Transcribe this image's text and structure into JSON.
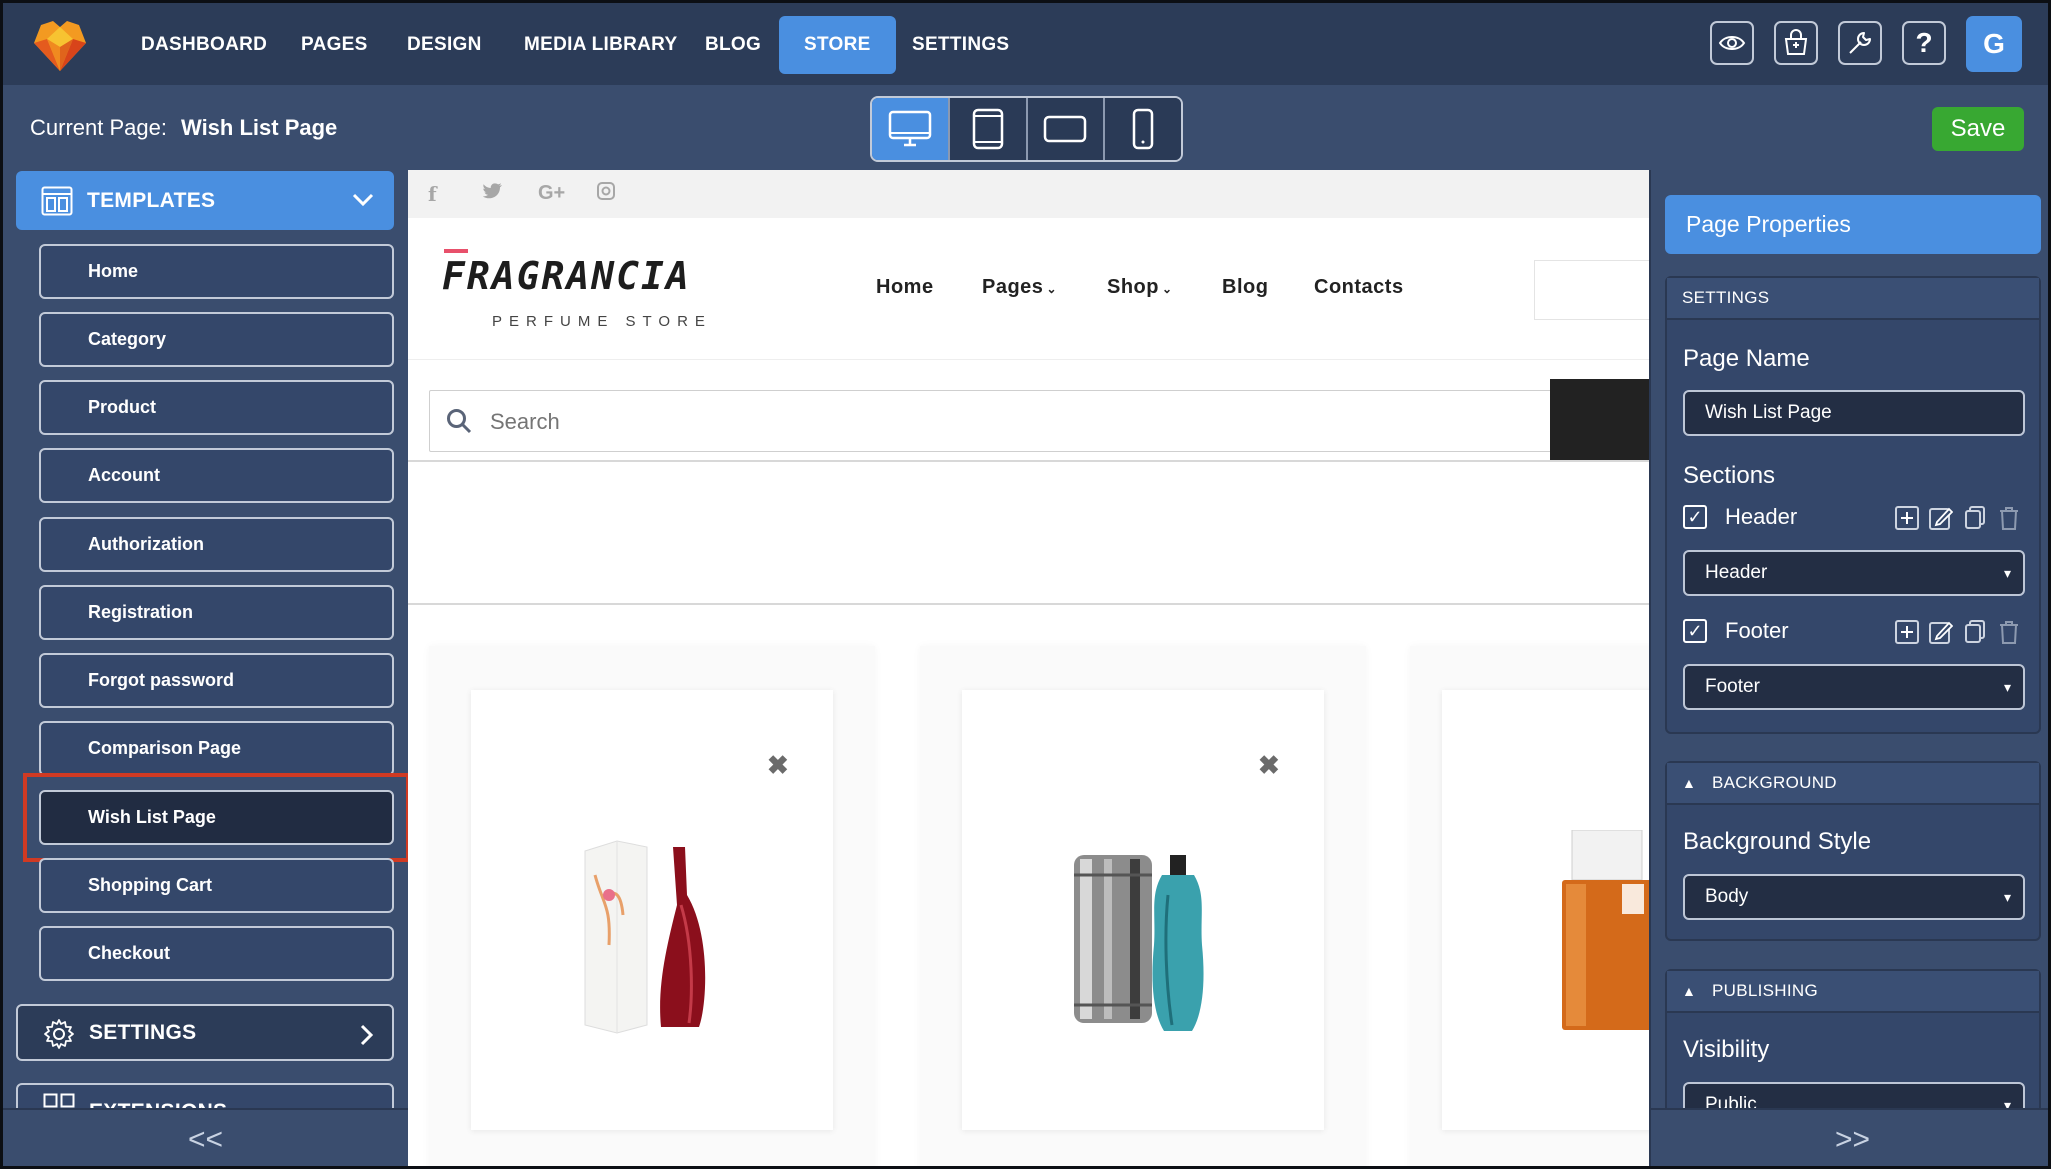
{
  "topnav": {
    "items": [
      "DASHBOARD",
      "PAGES",
      "DESIGN",
      "MEDIA LIBRARY",
      "BLOG",
      "STORE",
      "SETTINGS"
    ],
    "active": "STORE",
    "icons": [
      "eye-icon",
      "basket-icon",
      "wrench-icon",
      "help-icon"
    ],
    "avatar_letter": "G"
  },
  "subbar": {
    "current_label": "Current Page:",
    "current_value": "Wish List Page",
    "devices": [
      "desktop-icon",
      "tablet-portrait-icon",
      "tablet-landscape-icon",
      "mobile-icon"
    ],
    "active_device": "desktop",
    "save_label": "Save"
  },
  "sidebar": {
    "templates_title": "TEMPLATES",
    "templates": [
      "Home",
      "Category",
      "Product",
      "Account",
      "Authorization",
      "Registration",
      "Forgot password",
      "Comparison Page",
      "Wish List Page",
      "Shopping Cart",
      "Checkout"
    ],
    "selected": "Wish List Page",
    "settings_title": "SETTINGS",
    "extensions_title": "EXTENSIONS",
    "collapse_glyph": "<<"
  },
  "preview": {
    "social_icons": [
      "f",
      "t",
      "G+",
      "ig"
    ],
    "brand": "FRAGRANCIA",
    "brand_sub": "PERFUME STORE",
    "nav": [
      "Home",
      "Pages",
      "Shop",
      "Blog",
      "Contacts"
    ],
    "search_placeholder": "Search",
    "products": [
      "kenzo-perfume-image",
      "jean-paul-gaultier-perfume-image",
      "clinique-happy-perfume-image"
    ],
    "remove_glyph": "✖"
  },
  "panel": {
    "title": "Page Properties",
    "settings_head": "SETTINGS",
    "page_name_label": "Page Name",
    "page_name_value": "Wish List Page",
    "sections_label": "Sections",
    "sections": [
      {
        "name": "Header",
        "checked": true,
        "value": "Header"
      },
      {
        "name": "Footer",
        "checked": true,
        "value": "Footer"
      }
    ],
    "background_head": "BACKGROUND",
    "background_label": "Background Style",
    "background_value": "Body",
    "publishing_head": "PUBLISHING",
    "visibility_label": "Visibility",
    "visibility_value": "Public",
    "expand_glyph": ">>"
  },
  "colors": {
    "accent": "#4a8fe0",
    "save": "#38a832",
    "highlight": "#d03a23",
    "brand_accent": "#e8506b"
  }
}
